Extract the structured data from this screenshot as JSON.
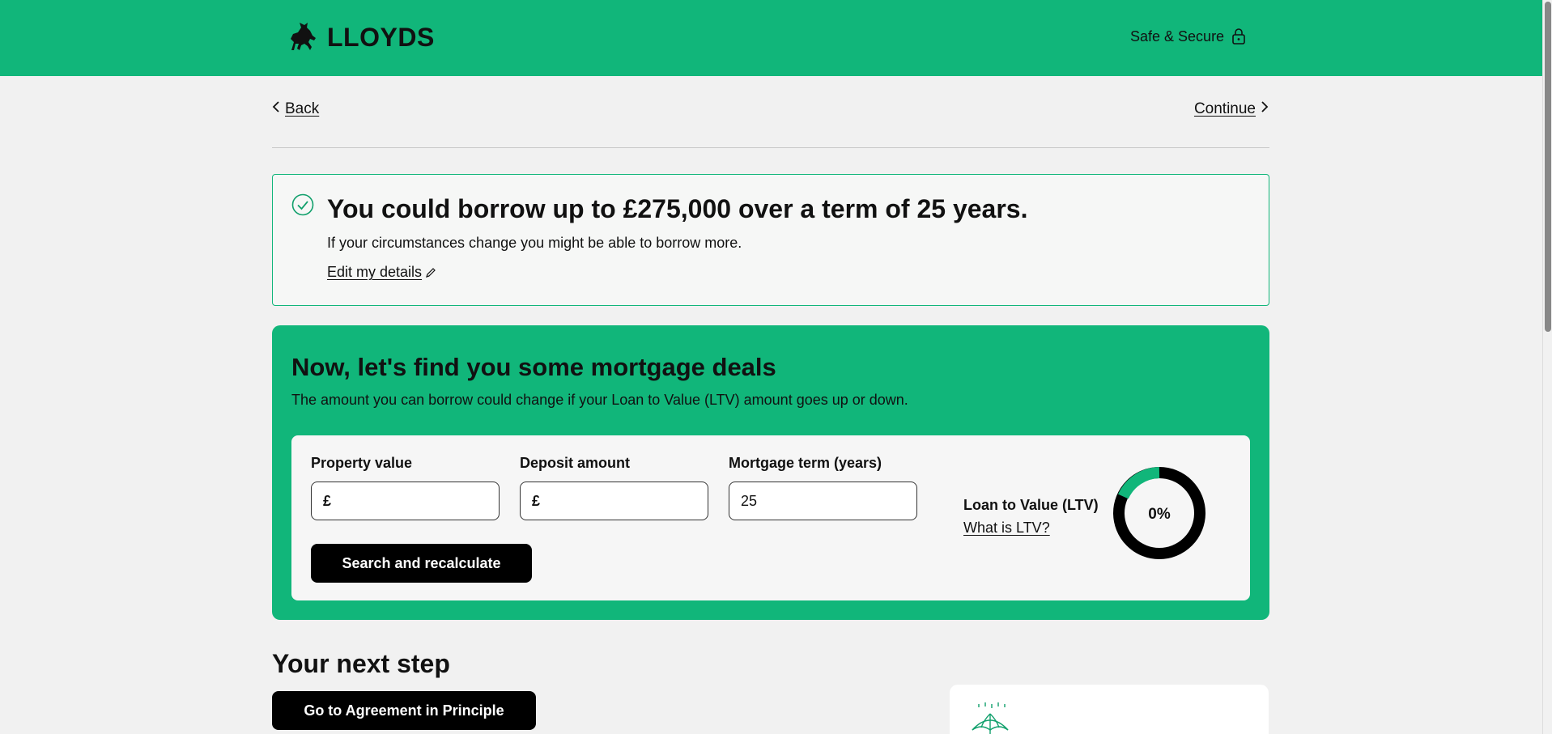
{
  "header": {
    "brand": "LLOYDS",
    "secure_label": "Safe & Secure",
    "background": "#11b67a"
  },
  "nav": {
    "back_label": "Back",
    "continue_label": "Continue"
  },
  "result": {
    "title": "You could borrow up to £275,000 over a term of 25 years.",
    "subtitle": "If your circumstances change you might be able to borrow more.",
    "edit_label": "Edit my details"
  },
  "deals": {
    "title": "Now, let's find you some mortgage deals",
    "subtitle": "The amount you can borrow could change if your Loan to Value (LTV) amount goes up or down.",
    "fields": [
      {
        "label": "Property value",
        "prefix": "£",
        "value": ""
      },
      {
        "label": "Deposit amount",
        "prefix": "£",
        "value": ""
      },
      {
        "label": "Mortgage term (years)",
        "prefix": "",
        "value": "25"
      }
    ],
    "search_button": "Search and recalculate",
    "ltv_label": "Loan to Value (LTV)",
    "ltv_link": "What is LTV?",
    "ltv_value": "0%",
    "ltv_percent": 0
  },
  "next": {
    "title": "Your next step",
    "aip_button": "Go to Agreement in Principle"
  }
}
